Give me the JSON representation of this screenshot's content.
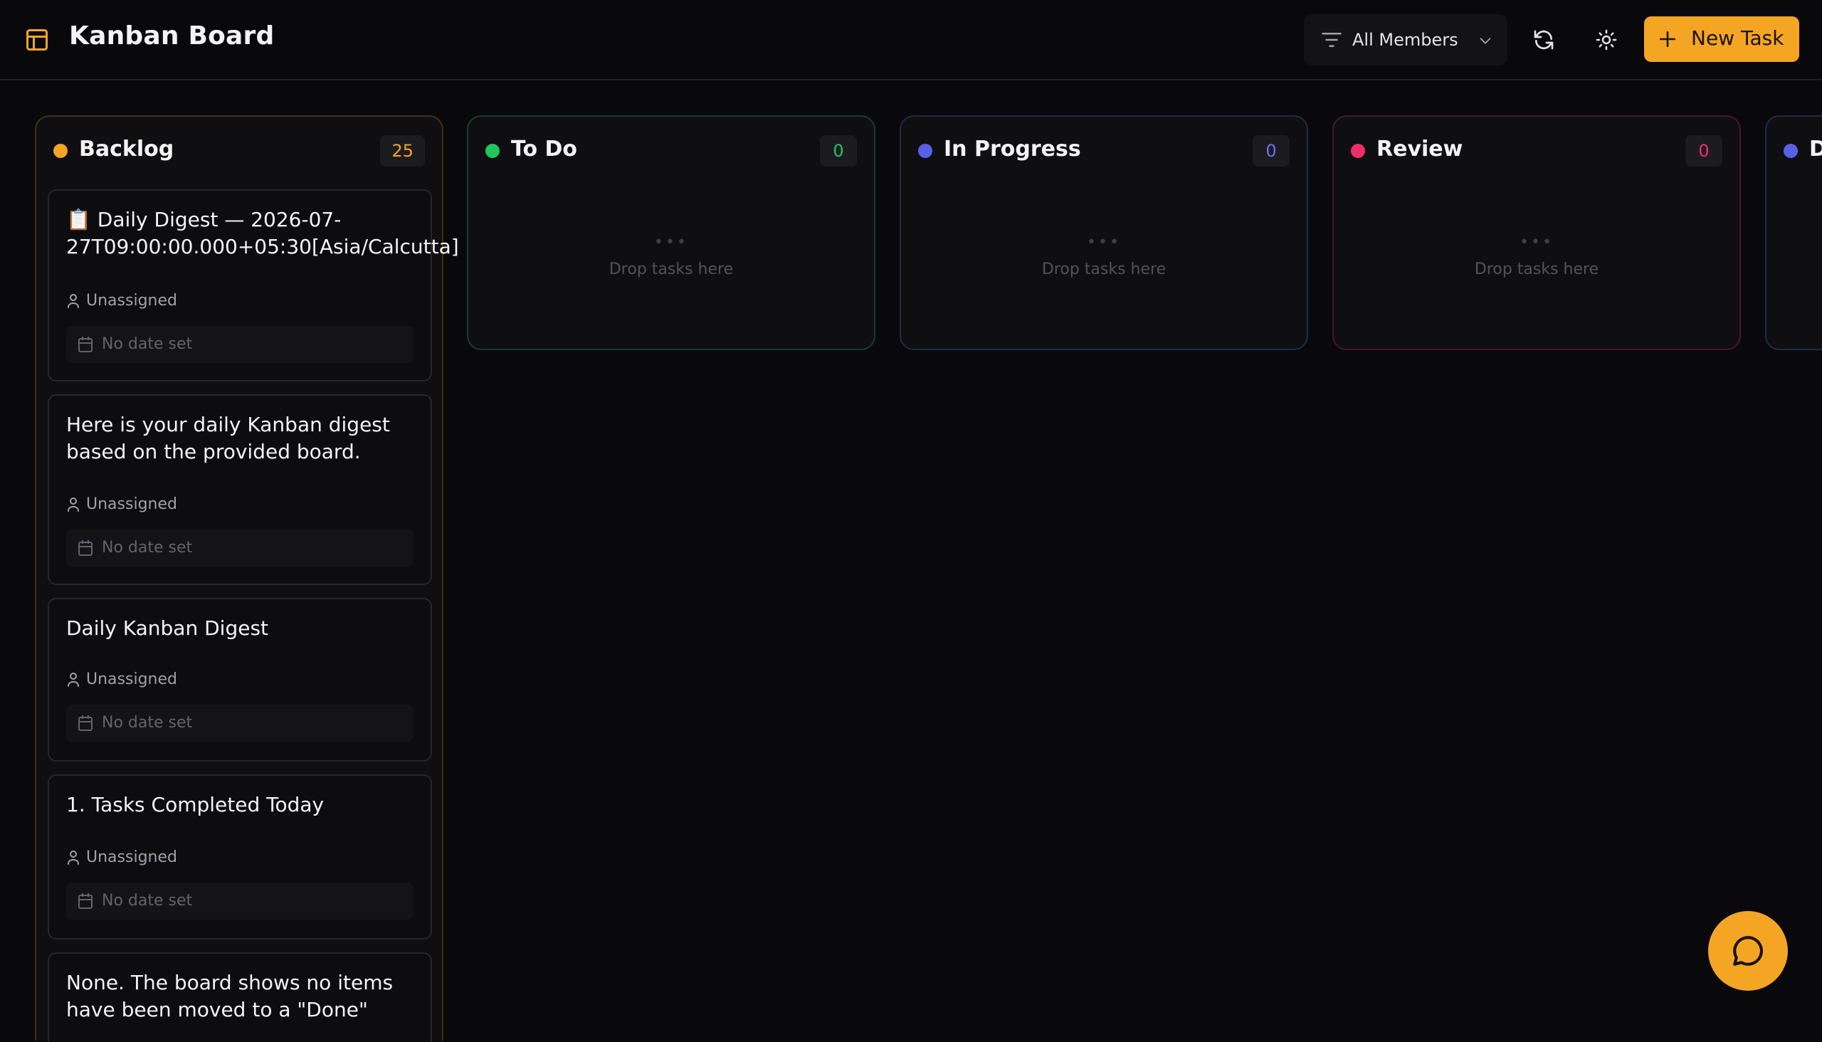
{
  "header": {
    "title": "Kanban Board",
    "filter_label": "All Members",
    "new_task_label": "New Task"
  },
  "icons": {
    "logo": "layout-board-icon",
    "filter": "filter-icon",
    "chevron": "chevron-down-icon",
    "refresh": "refresh-icon",
    "theme": "sun-icon",
    "add": "plus-icon",
    "chat": "chat-bubble-icon",
    "user": "user-icon",
    "calendar": "calendar-icon"
  },
  "colors": {
    "accent": "#f5a524",
    "backlog": "#f5a524",
    "todo": "#22c55e",
    "in_progress": "#5b5fe8",
    "review": "#ef2e6a",
    "done": "#5b5fe8"
  },
  "columns": [
    {
      "title": "Backlog",
      "count": "25",
      "cards": [
        {
          "title": "📋 Daily Digest — 2026-07-27T09:00:00.000+05:30[Asia/Calcutta]",
          "assignee": "Unassigned",
          "date": "No date set"
        },
        {
          "title": "Here is your daily Kanban digest based on the provided board.",
          "assignee": "Unassigned",
          "date": "No date set"
        },
        {
          "title": "Daily Kanban Digest",
          "assignee": "Unassigned",
          "date": "No date set"
        },
        {
          "title": "1. Tasks Completed Today",
          "assignee": "Unassigned",
          "date": "No date set"
        },
        {
          "title": "None. The board shows no items have been moved to a \"Done\"",
          "assignee": "",
          "date": ""
        }
      ]
    },
    {
      "title": "To Do",
      "count": "0",
      "empty_dots": "•••",
      "empty_text": "Drop tasks here"
    },
    {
      "title": "In Progress",
      "count": "0",
      "empty_dots": "•••",
      "empty_text": "Drop tasks here"
    },
    {
      "title": "Review",
      "count": "0",
      "empty_dots": "•••",
      "empty_text": "Drop tasks here"
    },
    {
      "title": "D",
      "count": ""
    }
  ]
}
